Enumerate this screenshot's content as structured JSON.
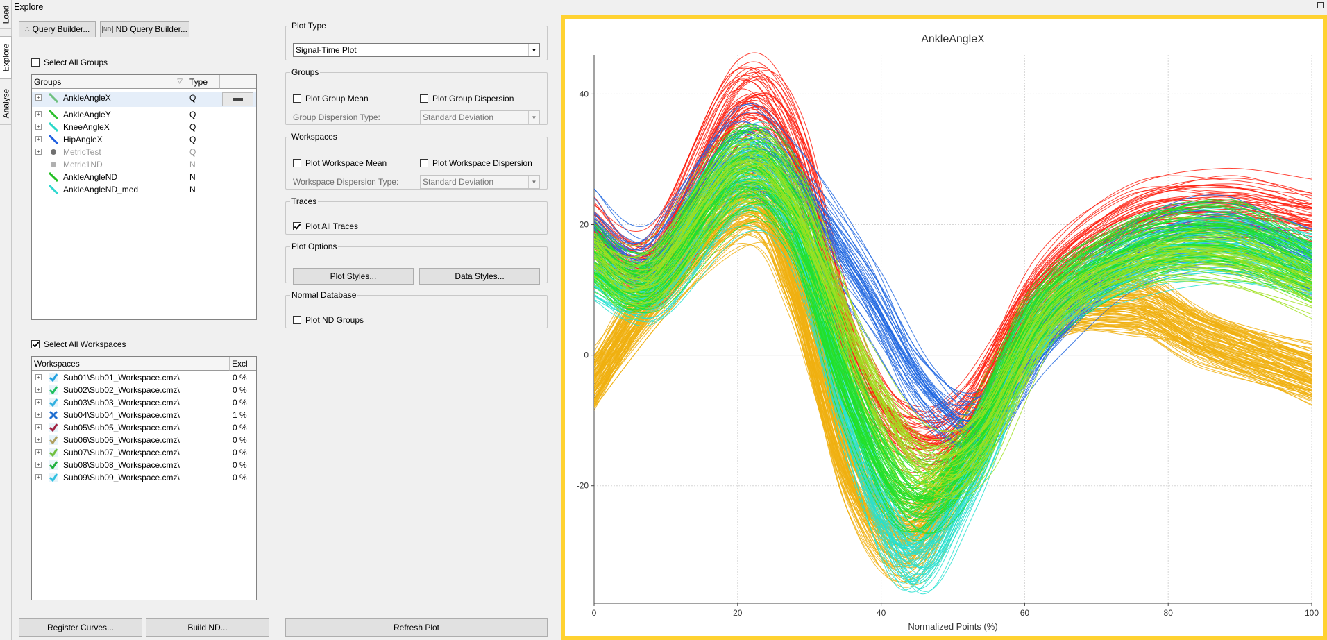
{
  "side_tabs": [
    "Load",
    "Explore",
    "Analyse"
  ],
  "window_title": "Explore",
  "buttons": {
    "query_builder": "Query Builder...",
    "nd_query_builder": "ND Query Builder...",
    "register_curves": "Register Curves...",
    "build_nd": "Build ND...",
    "refresh_plot": "Refresh Plot",
    "plot_styles": "Plot Styles...",
    "data_styles": "Data Styles..."
  },
  "select_all_groups": "Select All Groups",
  "groups_table": {
    "headers": [
      "Groups",
      "Type"
    ],
    "rows": [
      {
        "label": "AnkleAngleX",
        "type": "Q",
        "color": "#70c080",
        "expander": true,
        "icon": "line",
        "selected": true
      },
      {
        "label": "AnkleAngleY",
        "type": "Q",
        "color": "#2ec02e",
        "expander": true,
        "icon": "line"
      },
      {
        "label": "KneeAngleX",
        "type": "Q",
        "color": "#28d8c8",
        "expander": true,
        "icon": "line"
      },
      {
        "label": "HipAngleX",
        "type": "Q",
        "color": "#2060e0",
        "expander": true,
        "icon": "line"
      },
      {
        "label": "MetricTest",
        "type": "Q",
        "color": "#707070",
        "expander": true,
        "icon": "dot",
        "disabled": true
      },
      {
        "label": "Metric1ND",
        "type": "N",
        "color": "#b0b0b0",
        "expander": false,
        "icon": "dot",
        "disabled": true
      },
      {
        "label": "AnkleAngleND",
        "type": "N",
        "color": "#22c022",
        "expander": false,
        "icon": "line"
      },
      {
        "label": "AnkleAngleND_med",
        "type": "N",
        "color": "#30d8d0",
        "expander": false,
        "icon": "line"
      }
    ]
  },
  "select_all_workspaces": "Select All Workspaces",
  "workspaces_table": {
    "headers": [
      "Workspaces",
      "Excl"
    ],
    "rows": [
      {
        "label": "Sub01\\Sub01_Workspace.cmz\\",
        "excl": "0 %",
        "color": "#20a0e0",
        "icon": "check"
      },
      {
        "label": "Sub02\\Sub02_Workspace.cmz\\",
        "excl": "0 %",
        "color": "#20c060",
        "icon": "check"
      },
      {
        "label": "Sub03\\Sub03_Workspace.cmz\\",
        "excl": "0 %",
        "color": "#30b0e0",
        "icon": "check"
      },
      {
        "label": "Sub04\\Sub04_Workspace.cmz\\",
        "excl": "1 %",
        "color": "#1e6ed0",
        "icon": "cross"
      },
      {
        "label": "Sub05\\Sub05_Workspace.cmz\\",
        "excl": "0 %",
        "color": "#a02040",
        "icon": "check"
      },
      {
        "label": "Sub06\\Sub06_Workspace.cmz\\",
        "excl": "0 %",
        "color": "#b0a060",
        "icon": "check"
      },
      {
        "label": "Sub07\\Sub07_Workspace.cmz\\",
        "excl": "0 %",
        "color": "#70c040",
        "icon": "check"
      },
      {
        "label": "Sub08\\Sub08_Workspace.cmz\\",
        "excl": "0 %",
        "color": "#20b040",
        "icon": "check"
      },
      {
        "label": "Sub09\\Sub09_Workspace.cmz\\",
        "excl": "0 %",
        "color": "#30c0e0",
        "icon": "check"
      }
    ]
  },
  "plot_type": {
    "legend": "Plot Type",
    "value": "Signal-Time Plot"
  },
  "groups_box": {
    "legend": "Groups",
    "mean": "Plot Group Mean",
    "dispersion": "Plot Group Dispersion",
    "dispersion_type_label": "Group Dispersion Type:",
    "dispersion_type_value": "Standard Deviation"
  },
  "workspaces_box": {
    "legend": "Workspaces",
    "mean": "Plot Workspace Mean",
    "dispersion": "Plot Workspace Dispersion",
    "dispersion_type_label": "Workspace Dispersion Type:",
    "dispersion_type_value": "Standard Deviation"
  },
  "traces_box": {
    "legend": "Traces",
    "plot_all": "Plot All Traces",
    "plot_all_checked": true
  },
  "plot_options_box": {
    "legend": "Plot Options"
  },
  "normal_db_box": {
    "legend": "Normal Database",
    "plot_nd": "Plot ND Groups"
  },
  "chart_data": {
    "type": "line",
    "title": "AnkleAngleX",
    "xlabel": "Normalized Points (%)",
    "ylabel": "",
    "xlim": [
      0,
      100
    ],
    "ylim": [
      -38,
      46
    ],
    "xticks": [
      0,
      20,
      40,
      60,
      80,
      100
    ],
    "yticks": [
      -20,
      0,
      20,
      40
    ],
    "grid": true,
    "series": [
      {
        "color": "#f0b010",
        "count": 110,
        "values": [
          [
            0,
            -4
          ],
          [
            10,
            12
          ],
          [
            22,
            24
          ],
          [
            28,
            12
          ],
          [
            36,
            -18
          ],
          [
            44,
            -28
          ],
          [
            52,
            -15
          ],
          [
            62,
            5
          ],
          [
            75,
            8
          ],
          [
            85,
            3
          ],
          [
            100,
            -3
          ]
        ]
      },
      {
        "color": "#ff2010",
        "count": 50,
        "values": [
          [
            0,
            18
          ],
          [
            8,
            14
          ],
          [
            20,
            37
          ],
          [
            28,
            30
          ],
          [
            36,
            0
          ],
          [
            44,
            -12
          ],
          [
            52,
            -9
          ],
          [
            62,
            10
          ],
          [
            75,
            20
          ],
          [
            88,
            22
          ],
          [
            100,
            20
          ]
        ]
      },
      {
        "color": "#1e66e0",
        "count": 40,
        "values": [
          [
            0,
            19
          ],
          [
            8,
            14
          ],
          [
            20,
            31
          ],
          [
            28,
            26
          ],
          [
            38,
            10
          ],
          [
            46,
            -5
          ],
          [
            54,
            -11
          ],
          [
            64,
            4
          ],
          [
            76,
            16
          ],
          [
            88,
            19
          ],
          [
            100,
            14
          ]
        ]
      },
      {
        "color": "#26e0d0",
        "count": 60,
        "values": [
          [
            0,
            13
          ],
          [
            8,
            10
          ],
          [
            20,
            27
          ],
          [
            28,
            20
          ],
          [
            36,
            -10
          ],
          [
            44,
            -30
          ],
          [
            52,
            -18
          ],
          [
            62,
            5
          ],
          [
            75,
            14
          ],
          [
            88,
            17
          ],
          [
            100,
            14
          ]
        ]
      },
      {
        "color": "#22e028",
        "count": 70,
        "values": [
          [
            0,
            15
          ],
          [
            8,
            11
          ],
          [
            20,
            28
          ],
          [
            28,
            22
          ],
          [
            36,
            -6
          ],
          [
            44,
            -22
          ],
          [
            52,
            -16
          ],
          [
            62,
            6
          ],
          [
            75,
            16
          ],
          [
            88,
            18
          ],
          [
            100,
            13
          ]
        ]
      },
      {
        "color": "#a0e020",
        "count": 40,
        "values": [
          [
            0,
            16
          ],
          [
            8,
            12
          ],
          [
            20,
            29
          ],
          [
            28,
            24
          ],
          [
            38,
            -2
          ],
          [
            46,
            -16
          ],
          [
            54,
            -13
          ],
          [
            64,
            7
          ],
          [
            76,
            15
          ],
          [
            88,
            16
          ],
          [
            100,
            11
          ]
        ]
      }
    ]
  }
}
